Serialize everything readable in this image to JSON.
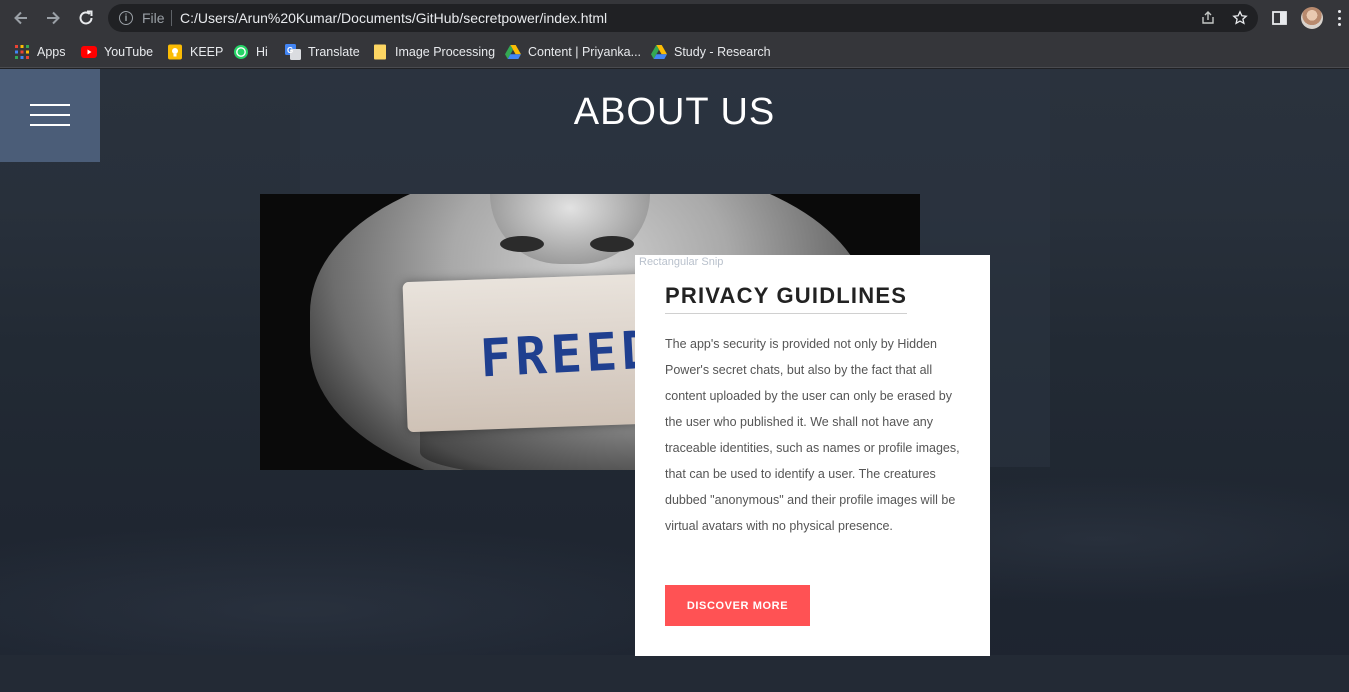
{
  "browser": {
    "scheme_label": "File",
    "url": "C:/Users/Arun%20Kumar/Documents/GitHub/secretpower/index.html",
    "bookmarks": [
      {
        "label": "Apps",
        "icon": "apps-grid-icon"
      },
      {
        "label": "YouTube",
        "icon": "youtube-icon"
      },
      {
        "label": "KEEP",
        "icon": "keep-icon"
      },
      {
        "label": "Hi",
        "icon": "whatsapp-icon"
      },
      {
        "label": "Translate",
        "icon": "translate-icon"
      },
      {
        "label": "Image Processing",
        "icon": "folder-icon"
      },
      {
        "label": "Content | Priyanka...",
        "icon": "google-drive-icon"
      },
      {
        "label": "Study - Research",
        "icon": "google-drive-icon"
      }
    ]
  },
  "page": {
    "title": "ABOUT US",
    "overlay_label": "Rectangular Snip",
    "image_text": "FREEDO",
    "card": {
      "title": "PRIVACY GUIDLINES",
      "body": "The app's security is provided not only by Hidden Power's secret chats, but also by the fact that all content uploaded by the user can only be erased by the user who published it. We shall not have any traceable identities, such as names or profile images, that can be used to identify a user. The creatures dubbed \"anonymous\" and their profile images will be virtual avatars with no physical presence.",
      "button_label": "DISCOVER MORE"
    }
  },
  "colors": {
    "accent": "#ff5254",
    "menu_bg": "#4b5d78",
    "page_bg": "#262e39"
  }
}
